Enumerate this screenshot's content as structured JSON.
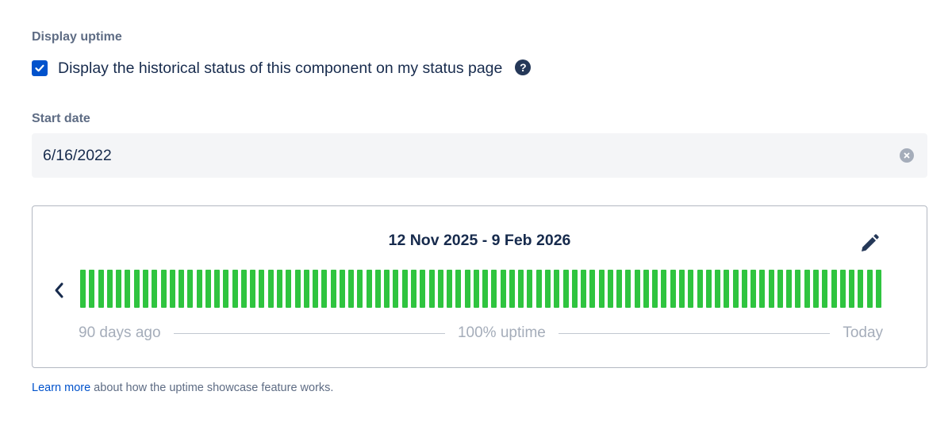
{
  "uptime_section": {
    "label": "Display uptime",
    "checkbox": {
      "checked": true,
      "label": "Display the historical status of this component on my status page"
    },
    "help_icon": "question-circle-icon",
    "help_glyph": "?"
  },
  "start_date": {
    "label": "Start date",
    "value": "6/16/2022",
    "clear_icon": "clear-circle-icon"
  },
  "preview": {
    "date_range": "12 Nov 2025 - 9 Feb 2026",
    "edit_icon": "pencil-icon",
    "prev_icon": "chevron-left-icon",
    "days_count": 90,
    "bar_color": "#2fc43f",
    "axis": {
      "start_label": "90 days ago",
      "middle_label": "100% uptime",
      "end_label": "Today"
    }
  },
  "footer": {
    "link_text": "Learn more",
    "rest_text": " about how the uptime showcase feature works."
  },
  "colors": {
    "accent": "#0052cc",
    "text": "#172b4d",
    "muted": "#5e6c84",
    "bar_operational": "#2fc43f"
  }
}
